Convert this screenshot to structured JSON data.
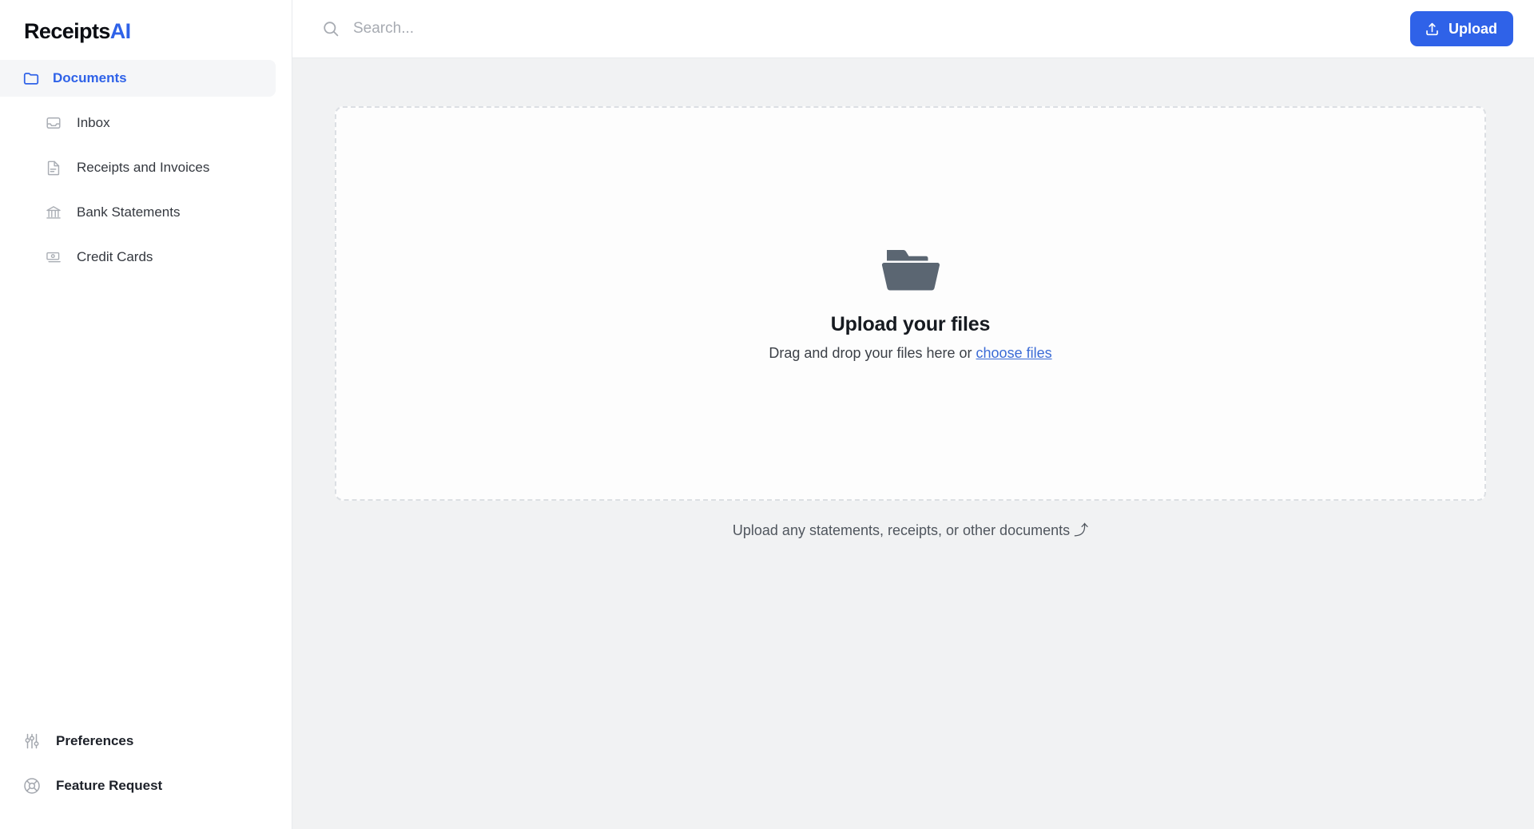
{
  "brand": {
    "name_main": "Receipts",
    "name_accent": "AI",
    "accent_color": "#2f62e8"
  },
  "sidebar": {
    "primary": {
      "label": "Documents",
      "icon": "folder-icon",
      "active": true
    },
    "items": [
      {
        "label": "Inbox",
        "icon": "inbox-icon"
      },
      {
        "label": "Receipts and Invoices",
        "icon": "document-icon"
      },
      {
        "label": "Bank Statements",
        "icon": "bank-icon"
      },
      {
        "label": "Credit Cards",
        "icon": "banknote-icon"
      }
    ],
    "bottom_items": [
      {
        "label": "Preferences",
        "icon": "sliders-icon"
      },
      {
        "label": "Feature Request",
        "icon": "lifebuoy-icon"
      }
    ]
  },
  "topbar": {
    "search": {
      "placeholder": "Search...",
      "value": "",
      "icon": "search-icon"
    },
    "upload_button": {
      "label": "Upload",
      "icon": "upload-icon",
      "color": "#2f62e8"
    }
  },
  "main": {
    "dropzone": {
      "icon": "folder-icon",
      "title": "Upload your files",
      "subtitle_prefix": "Drag and drop your files here or ",
      "choose_link": "choose files"
    },
    "caption": "Upload any statements, receipts, or other documents ⤴"
  }
}
